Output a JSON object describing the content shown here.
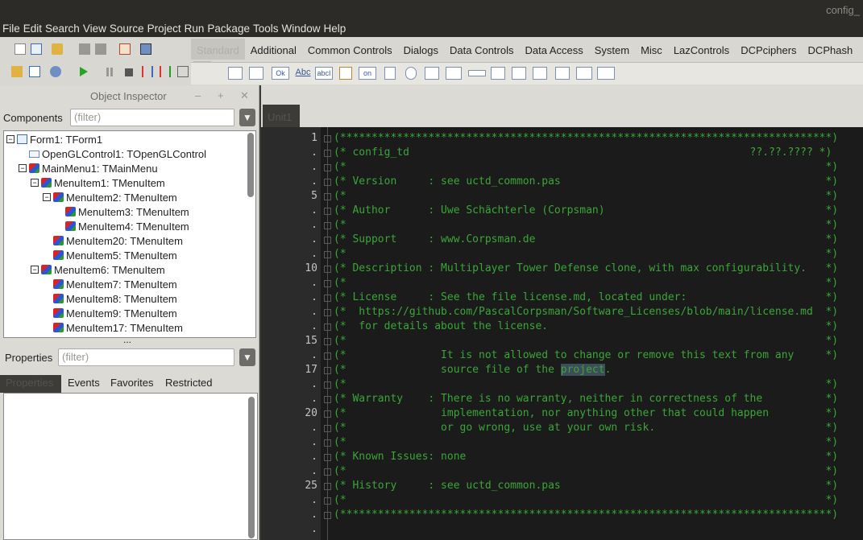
{
  "window": {
    "title": "config_"
  },
  "menu": [
    "File",
    "Edit",
    "Search",
    "View",
    "Source",
    "Project",
    "Run",
    "Package",
    "Tools",
    "Window",
    "Help"
  ],
  "palette": {
    "tabs": [
      "Standard",
      "Additional",
      "Common Controls",
      "Dialogs",
      "Data Controls",
      "Data Access",
      "System",
      "Misc",
      "LazControls",
      "DCPciphers",
      "DCPhash"
    ],
    "icons": [
      "Ok",
      "Abc",
      "abcI",
      "on"
    ]
  },
  "object_inspector": {
    "title": "Object Inspector",
    "components_label": "Components",
    "components_filter_placeholder": "(filter)",
    "tree": [
      {
        "label": "Form1: TForm1",
        "icon": "form-icon"
      },
      {
        "label": "OpenGLControl1: TOpenGLControl",
        "icon": "opengl-control-icon"
      },
      {
        "label": "MainMenu1: TMainMenu",
        "icon": "menu-icon"
      },
      {
        "label": "MenuItem1: TMenuItem",
        "icon": "menu-icon"
      },
      {
        "label": "MenuItem2: TMenuItem",
        "icon": "menu-icon"
      },
      {
        "label": "MenuItem3: TMenuItem",
        "icon": "menu-icon"
      },
      {
        "label": "MenuItem4: TMenuItem",
        "icon": "menu-icon"
      },
      {
        "label": "MenuItem20: TMenuItem",
        "icon": "menu-icon"
      },
      {
        "label": "MenuItem5: TMenuItem",
        "icon": "menu-icon"
      },
      {
        "label": "MenuItem6: TMenuItem",
        "icon": "menu-icon"
      },
      {
        "label": "MenuItem7: TMenuItem",
        "icon": "menu-icon"
      },
      {
        "label": "MenuItem8: TMenuItem",
        "icon": "menu-icon"
      },
      {
        "label": "MenuItem9: TMenuItem",
        "icon": "menu-icon"
      },
      {
        "label": "MenuItem17: TMenuItem",
        "icon": "menu-icon"
      }
    ],
    "splitter": "...",
    "properties_label": "Properties",
    "properties_filter_placeholder": "(filter)",
    "prop_tabs": [
      "Properties",
      "Events",
      "Favorites",
      "Restricted"
    ]
  },
  "editor": {
    "tab": "Unit1",
    "gutter": [
      "1",
      ".",
      ".",
      ".",
      "5",
      ".",
      ".",
      ".",
      ".",
      "10",
      ".",
      ".",
      ".",
      ".",
      "15",
      ".",
      "17",
      ".",
      ".",
      "20",
      ".",
      ".",
      ".",
      ".",
      "25",
      ".",
      ".",
      "."
    ],
    "lines": [
      "(******************************************************************************)",
      "(* config_td                                                      ??.??.???? *)",
      "(*                                                                            *)",
      "(* Version     : see uctd_common.pas                                          *)",
      "(*                                                                            *)",
      "(* Author      : Uwe Schächterle (Corpsman)                                   *)",
      "(*                                                                            *)",
      "(* Support     : www.Corpsman.de                                              *)",
      "(*                                                                            *)",
      "(* Description : Multiplayer Tower Defense clone, with max configurability.   *)",
      "(*                                                                            *)",
      "(* License     : See the file license.md, located under:                      *)",
      "(*  https://github.com/PascalCorpsman/Software_Licenses/blob/main/license.md  *)",
      "(*  for details about the license.                                            *)",
      "(*                                                                            *)",
      "(*               It is not allowed to change or remove this text from any     *)",
      "(*               source file of the ",
      "(*                                                                            *)",
      "(* Warranty    : There is no warranty, neither in correctness of the          *)",
      "(*               implementation, nor anything other that could happen         *)",
      "(*               or go wrong, use at your own risk.                           *)",
      "(*                                                                            *)",
      "(* Known Issues: none                                                         *)",
      "(*                                                                            *)",
      "(* History     : see uctd_common.pas                                          *)",
      "(*                                                                            *)",
      "(******************************************************************************)",
      ""
    ],
    "highlight_word": "project",
    "line17_tail": ".                                        *)",
    "colors": {
      "comment": "#3aa637",
      "background": "#1b1b1b",
      "gutter": "#2b2b2b"
    }
  }
}
